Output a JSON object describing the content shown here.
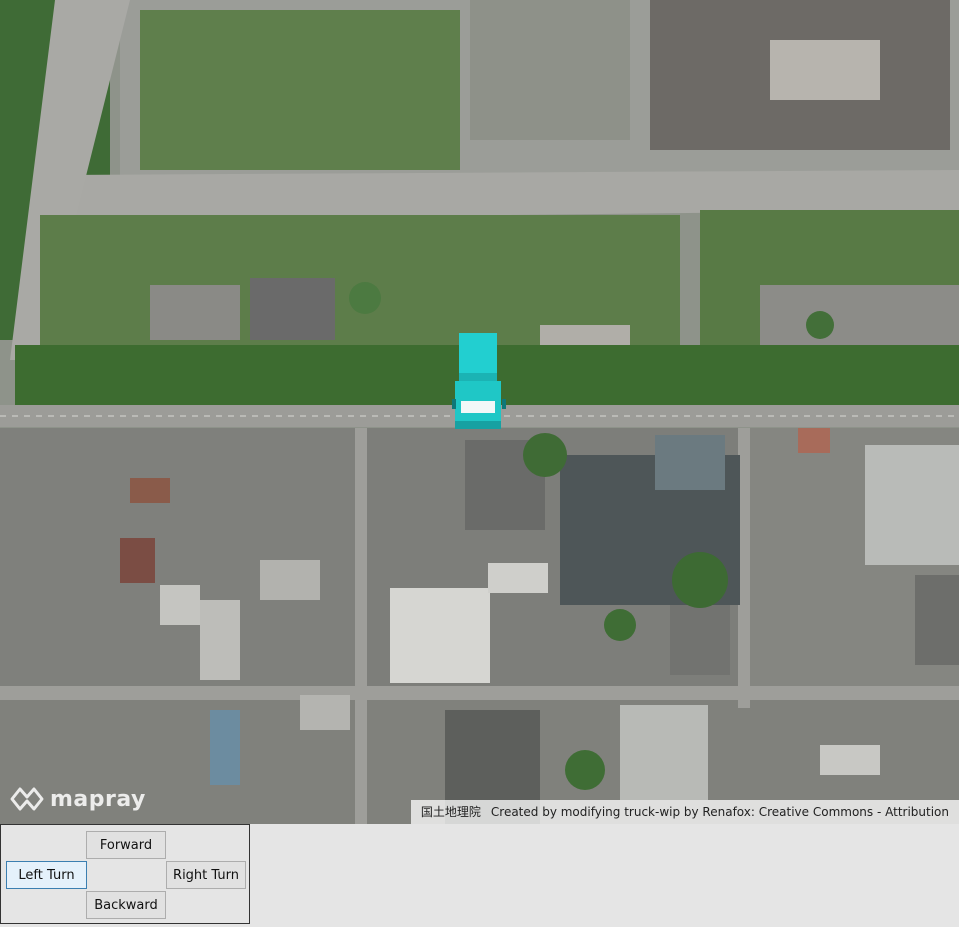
{
  "map": {
    "logo_text": "mapray",
    "attribution": {
      "source": "国土地理院",
      "credit": "Created by modifying truck-wip by Renafox: Creative Commons - Attribution"
    }
  },
  "controls": {
    "forward": "Forward",
    "left_turn": "Left Turn",
    "right_turn": "Right Turn",
    "backward": "Backward"
  },
  "colors": {
    "truck_cab": "#1fc7c6",
    "truck_body": "#22cfd0"
  }
}
